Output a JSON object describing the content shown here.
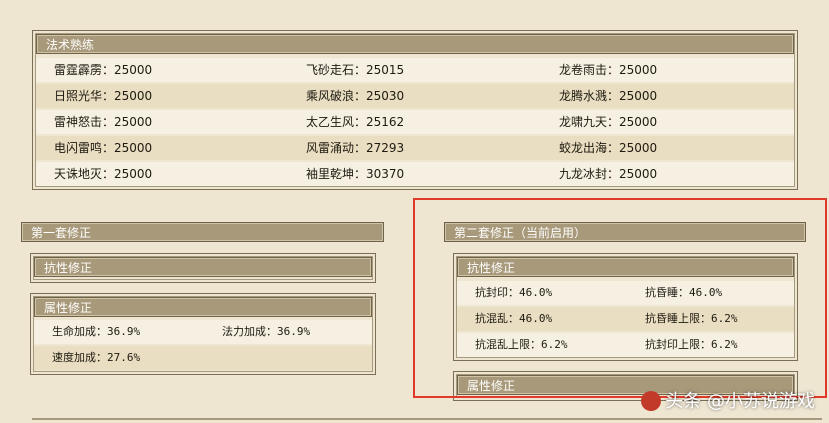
{
  "spell_mastery": {
    "title": "法术熟练",
    "rows": [
      [
        {
          "label": "雷霆霹雳：25000"
        },
        {
          "label": "飞砂走石：25015"
        },
        {
          "label": "龙卷雨击：25000"
        }
      ],
      [
        {
          "label": "日照光华：25000"
        },
        {
          "label": "乘风破浪：25030"
        },
        {
          "label": "龙腾水溅：25000"
        }
      ],
      [
        {
          "label": "雷神怒击：25000"
        },
        {
          "label": "太乙生风：25162"
        },
        {
          "label": "龙啸九天：25000"
        }
      ],
      [
        {
          "label": "电闪雷鸣：25000"
        },
        {
          "label": "风雷涌动：27293"
        },
        {
          "label": "蛟龙出海：25000"
        }
      ],
      [
        {
          "label": "天诛地灭：25000"
        },
        {
          "label": "袖里乾坤：30370"
        },
        {
          "label": "九龙冰封：25000"
        }
      ]
    ]
  },
  "set1": {
    "title": "第一套修正",
    "resist_title": "抗性修正",
    "attr_title": "属性修正",
    "attr_rows": [
      [
        "生命加成：36.9%",
        "法力加成：36.9%"
      ],
      [
        "速度加成：27.6%",
        ""
      ]
    ]
  },
  "set2": {
    "title": "第二套修正（当前启用）",
    "resist_title": "抗性修正",
    "resist_rows": [
      [
        "抗封印：46.0%",
        "抗昏睡：46.0%"
      ],
      [
        "抗混乱：46.0%",
        "抗昏睡上限：6.2%"
      ],
      [
        "抗混乱上限：6.2%",
        "抗封印上限：6.2%"
      ]
    ],
    "attr_title": "属性修正"
  },
  "watermark": {
    "text": "头条 @小苏说游戏"
  },
  "colors": {
    "header_bg": "#a8997a",
    "highlight_border": "#e03a2a",
    "page_bg": "#efe6d2"
  }
}
